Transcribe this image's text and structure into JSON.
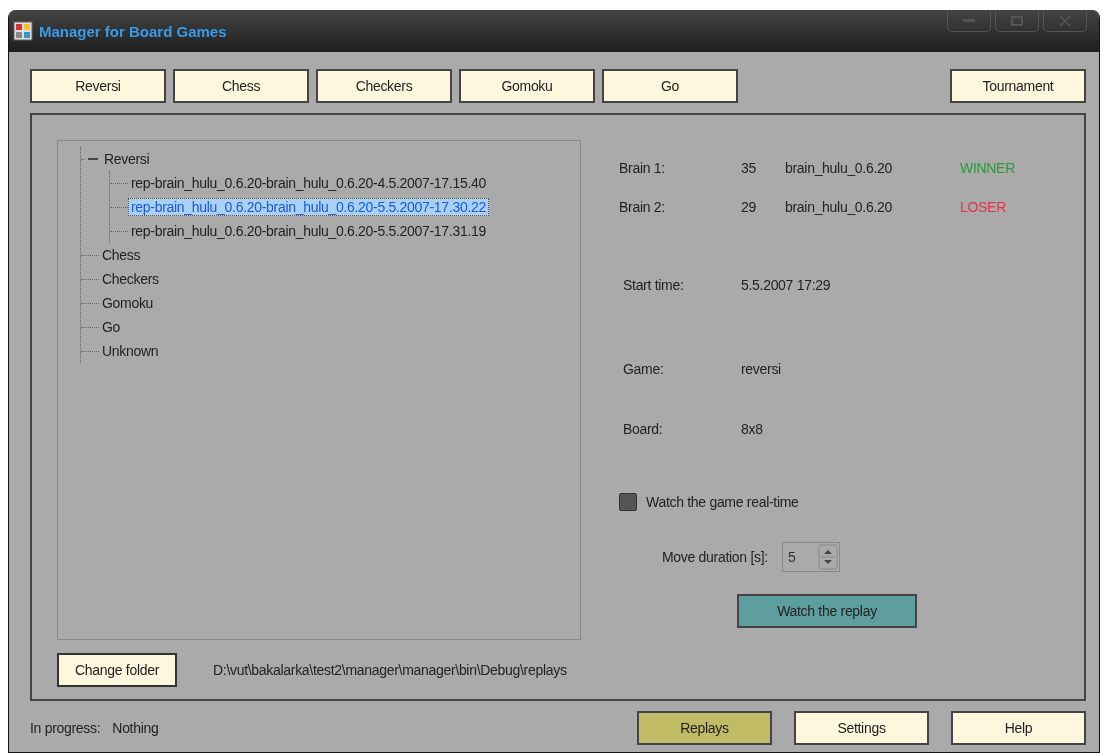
{
  "window": {
    "title": "Manager for Board Games"
  },
  "game_buttons": [
    {
      "label": "Reversi"
    },
    {
      "label": "Chess"
    },
    {
      "label": "Checkers"
    },
    {
      "label": "Gomoku"
    },
    {
      "label": "Go"
    }
  ],
  "tournament_button": {
    "label": "Tournament"
  },
  "tree": [
    {
      "label": "Reversi",
      "selected": false,
      "expanded": true,
      "children": [
        {
          "label": "rep-brain_hulu_0.6.20-brain_hulu_0.6.20-4.5.2007-17.15.40",
          "selected": false
        },
        {
          "label": "rep-brain_hulu_0.6.20-brain_hulu_0.6.20-5.5.2007-17.30.22",
          "selected": true
        },
        {
          "label": "rep-brain_hulu_0.6.20-brain_hulu_0.6.20-5.5.2007-17.31.19",
          "selected": false
        }
      ]
    },
    {
      "label": "Chess",
      "selected": false
    },
    {
      "label": "Checkers",
      "selected": false
    },
    {
      "label": "Gomoku",
      "selected": false
    },
    {
      "label": "Go",
      "selected": false
    },
    {
      "label": "Unknown",
      "selected": false
    }
  ],
  "details": {
    "brains": [
      {
        "label": "Brain 1:",
        "score": "35",
        "name": "brain_hulu_0.6.20",
        "result": "WINNER",
        "kind": "winner"
      },
      {
        "label": "Brain 2:",
        "score": "29",
        "name": "brain_hulu_0.6.20",
        "result": "LOSER",
        "kind": "loser"
      }
    ],
    "fields": [
      {
        "label": "Start time:",
        "value": "5.5.2007 17:29"
      },
      {
        "label": "Game:",
        "value": "reversi"
      },
      {
        "label": "Board:",
        "value": "8x8"
      }
    ],
    "realtime": {
      "label": "Watch the game real-time",
      "checked": false
    },
    "move_duration": {
      "label": "Move duration [s]:",
      "value": "5"
    },
    "watch_button": {
      "label": "Watch the replay"
    }
  },
  "folder": {
    "button": "Change folder",
    "path": "D:\\vut\\bakalarka\\test2\\manager\\manager\\bin\\Debug\\replays"
  },
  "status": {
    "label": "In progress:",
    "value": "Nothing"
  },
  "nav": [
    {
      "label": "Replays",
      "selected": true
    },
    {
      "label": "Settings",
      "selected": false
    },
    {
      "label": "Help",
      "selected": false
    }
  ]
}
